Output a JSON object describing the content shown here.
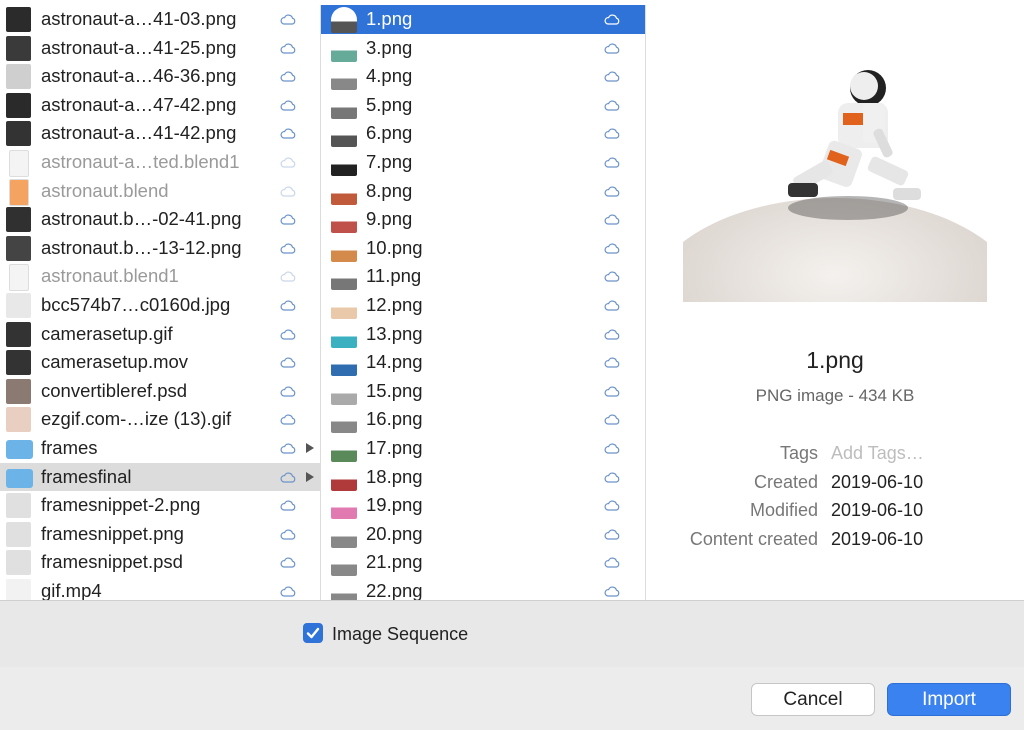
{
  "left_column": {
    "items": [
      {
        "name": "astronaut-a…41-03.png",
        "dim": false,
        "folder": false
      },
      {
        "name": "astronaut-a…41-25.png",
        "dim": false,
        "folder": false
      },
      {
        "name": "astronaut-a…46-36.png",
        "dim": false,
        "folder": false
      },
      {
        "name": "astronaut-a…47-42.png",
        "dim": false,
        "folder": false
      },
      {
        "name": "astronaut-a…41-42.png",
        "dim": false,
        "folder": false
      },
      {
        "name": "astronaut-a…ted.blend1",
        "dim": true,
        "folder": false
      },
      {
        "name": "astronaut.blend",
        "dim": true,
        "folder": false
      },
      {
        "name": "astronaut.b…-02-41.png",
        "dim": false,
        "folder": false
      },
      {
        "name": "astronaut.b…-13-12.png",
        "dim": false,
        "folder": false
      },
      {
        "name": "astronaut.blend1",
        "dim": true,
        "folder": false
      },
      {
        "name": "bcc574b7…c0160d.jpg",
        "dim": false,
        "folder": false
      },
      {
        "name": "camerasetup.gif",
        "dim": false,
        "folder": false
      },
      {
        "name": "camerasetup.mov",
        "dim": false,
        "folder": false
      },
      {
        "name": "convertibleref.psd",
        "dim": false,
        "folder": false
      },
      {
        "name": "ezgif.com-…ize (13).gif",
        "dim": false,
        "folder": false
      },
      {
        "name": "frames",
        "dim": false,
        "folder": true
      },
      {
        "name": "framesfinal",
        "dim": false,
        "folder": true,
        "selected": true
      },
      {
        "name": "framesnippet-2.png",
        "dim": false,
        "folder": false
      },
      {
        "name": "framesnippet.png",
        "dim": false,
        "folder": false
      },
      {
        "name": "framesnippet.psd",
        "dim": false,
        "folder": false
      },
      {
        "name": "gif.mp4",
        "dim": false,
        "folder": false
      }
    ]
  },
  "right_column": {
    "items": [
      {
        "name": "1.png",
        "selected": true
      },
      {
        "name": "3.png"
      },
      {
        "name": "4.png"
      },
      {
        "name": "5.png"
      },
      {
        "name": "6.png"
      },
      {
        "name": "7.png"
      },
      {
        "name": "8.png"
      },
      {
        "name": "9.png"
      },
      {
        "name": "10.png"
      },
      {
        "name": "11.png"
      },
      {
        "name": "12.png"
      },
      {
        "name": "13.png"
      },
      {
        "name": "14.png"
      },
      {
        "name": "15.png"
      },
      {
        "name": "16.png"
      },
      {
        "name": "17.png"
      },
      {
        "name": "18.png"
      },
      {
        "name": "19.png"
      },
      {
        "name": "20.png"
      },
      {
        "name": "21.png"
      },
      {
        "name": "22.png"
      }
    ]
  },
  "preview": {
    "filename": "1.png",
    "kind": "PNG image - 434 KB",
    "meta": [
      {
        "label": "Tags",
        "value": "Add Tags…",
        "placeholder": true
      },
      {
        "label": "Created",
        "value": "2019-06-10"
      },
      {
        "label": "Modified",
        "value": "2019-06-10"
      },
      {
        "label": "Content created",
        "value": "2019-06-10"
      }
    ]
  },
  "options": {
    "image_sequence_label": "Image Sequence",
    "image_sequence_checked": true
  },
  "buttons": {
    "cancel": "Cancel",
    "import": "Import"
  },
  "colors": {
    "selection": "#2f73d8",
    "accent": "#3b82f1",
    "folder": "#6cb4e8"
  }
}
